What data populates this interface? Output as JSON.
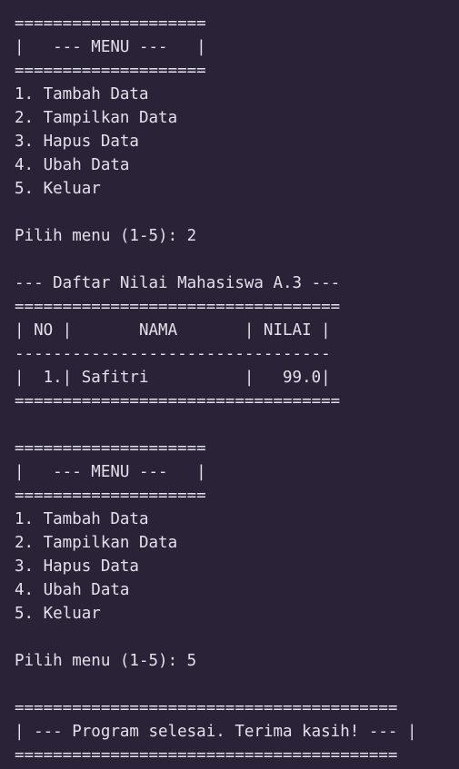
{
  "terminal": {
    "lines": [
      "====================",
      "|   --- MENU ---   |",
      "====================",
      "1. Tambah Data",
      "2. Tampilkan Data",
      "3. Hapus Data",
      "4. Ubah Data",
      "5. Keluar",
      "",
      "Pilih menu (1-5): 2",
      "",
      "--- Daftar Nilai Mahasiswa A.3 ---",
      "==================================",
      "| NO |       NAMA       | NILAI |",
      "---------------------------------",
      "|  1.| Safitri          |   99.0|",
      "==================================",
      "",
      "====================",
      "|   --- MENU ---   |",
      "====================",
      "1. Tambah Data",
      "2. Tampilkan Data",
      "3. Hapus Data",
      "4. Ubah Data",
      "5. Keluar",
      "",
      "Pilih menu (1-5): 5",
      "",
      "========================================",
      "| --- Program selesai. Terima kasih! --- |",
      "========================================"
    ]
  }
}
